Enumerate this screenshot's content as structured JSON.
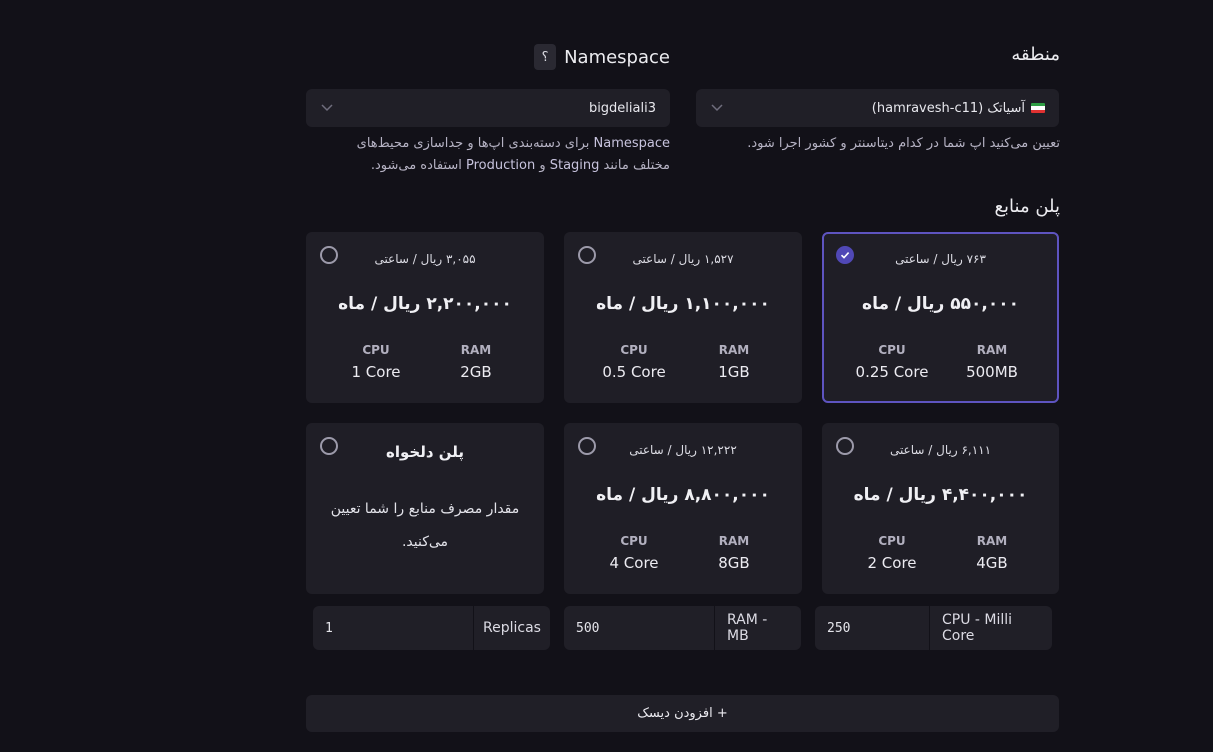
{
  "region": {
    "title": "منطقه",
    "selected": "آسیاتک (hamravesh-c11)",
    "description": "تعیین می‌کنید اپ شما در کدام دیتاسنتر و کشور اجرا شود."
  },
  "namespace": {
    "title": "Namespace",
    "help": "؟",
    "selected": "bigdeliali3",
    "description_line1_en": "Namespace",
    "description_line1_fa": " برای دسته‌بندی اپ‌ها و جداسازی محیط‌های",
    "description_line2_a": "مختلف مانند ",
    "description_line2_staging": "Staging",
    "description_line2_and": " و ",
    "description_line2_production": "Production",
    "description_line2_b": " استفاده می‌شود."
  },
  "plans": {
    "title": "پلن منابع",
    "items": [
      {
        "hourly": "۷۶۳ ریال / ساعتی",
        "monthly": "۵۵۰,۰۰۰ ریال / ماه",
        "cpu_label": "CPU",
        "cpu": "0.25 Core",
        "ram_label": "RAM",
        "ram": "500MB",
        "selected": true
      },
      {
        "hourly": "۱,۵۲۷ ریال / ساعتی",
        "monthly": "۱,۱۰۰,۰۰۰ ریال / ماه",
        "cpu_label": "CPU",
        "cpu": "0.5 Core",
        "ram_label": "RAM",
        "ram": "1GB",
        "selected": false
      },
      {
        "hourly": "۳,۰۵۵ ریال / ساعتی",
        "monthly": "۲,۲۰۰,۰۰۰ ریال / ماه",
        "cpu_label": "CPU",
        "cpu": "1 Core",
        "ram_label": "RAM",
        "ram": "2GB",
        "selected": false
      },
      {
        "hourly": "۶,۱۱۱ ریال / ساعتی",
        "monthly": "۴,۴۰۰,۰۰۰ ریال / ماه",
        "cpu_label": "CPU",
        "cpu": "2 Core",
        "ram_label": "RAM",
        "ram": "4GB",
        "selected": false
      },
      {
        "hourly": "۱۲,۲۲۲ ریال / ساعتی",
        "monthly": "۸,۸۰۰,۰۰۰ ریال / ماه",
        "cpu_label": "CPU",
        "cpu": "4 Core",
        "ram_label": "RAM",
        "ram": "8GB",
        "selected": false
      }
    ],
    "custom": {
      "title": "پلن دلخواه",
      "description": "مقدار مصرف منابع را شما تعیین می‌کنید."
    }
  },
  "inputs": {
    "cpu": {
      "label": "CPU - Milli Core",
      "value": "250"
    },
    "ram": {
      "label": "RAM - MB",
      "value": "500"
    },
    "replicas": {
      "label": "Replicas",
      "value": "1"
    }
  },
  "add_disk": "+ افزودن دیسک",
  "colors": {
    "accent": "#5e54c0",
    "card": "#1f1e26",
    "background": "#121118"
  },
  "icons": {
    "chevron": "chevron-down-icon",
    "check": "check-icon",
    "flag": "iran-flag-icon"
  }
}
